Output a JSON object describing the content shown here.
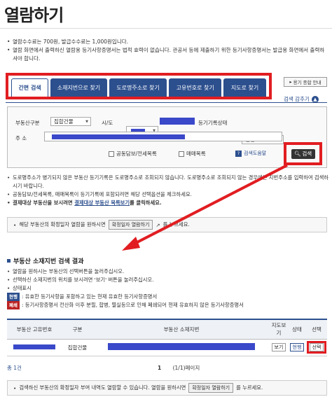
{
  "page": {
    "title": "열람하기"
  },
  "top_notes": [
    "열람수수료는 700원, 발급수수료는 1,000원입니다.",
    "열람 화면에서 출력하신 열람용 등기사항증명서는 법적 효력이 없습니다. 관공서 등에 제출하기 위한 등기사항증명서는 발급용 화면에서 출력하셔야 합니다."
  ],
  "tabs": [
    {
      "label": "간편 검색"
    },
    {
      "label": "소재지번으로 찾기"
    },
    {
      "label": "도로명주소로 찾기"
    },
    {
      "label": "고유번호로 찾기"
    },
    {
      "label": "지도로 찾기"
    }
  ],
  "guide_button": "용기 종합 안내",
  "collapse_label": "검색 감추기",
  "form": {
    "type_label": "부동산구분",
    "type_value": "집합건물",
    "sido_label": "시/도",
    "record_label": "등기기록상태",
    "record_value": "현행",
    "address_label": "주 소",
    "check1": "공동담보/전세목록",
    "check2": "매매목록",
    "help_label": "검색도움말",
    "search_button": "검색"
  },
  "mid_notes": [
    "도로명주소가 병기되지 않은 부동산 등기기록은 도로명주소로 조회되지 않습니다. 도로명주소로 조회되지 않는 경우에는 지번주소를 입력하여 검색하시기 바랍니다.",
    "공동담보/전세목록, 매매목록이 등기기록에 포함되려면 해당 선택옵션을 체크하세요."
  ],
  "batch_note": {
    "prefix": "결제대상 부동산을 보시려면",
    "link": "결제대상 부동산 목록보기",
    "suffix": "를 클릭하세요."
  },
  "confirm_note": {
    "prefix": "해당 부동산의 확정일자 열람을 원하시면",
    "button": "확정일자 열람하기",
    "suffix": "를 누르세요."
  },
  "results": {
    "title": "부동산 소재지번 검색 결과",
    "notes": [
      "열람을 원하시는 부동산의 선택버튼을 눌러주십시오.",
      "선택하신 소재지번의 위치를 보시려면 '보기' 버튼을 눌러주십시오.",
      "상태표시"
    ],
    "tag1": "현행",
    "tag1_text": ": 유효한 등기사항을 포함하고 있는 현재 유효한 등기사항증명서",
    "tag2": "폐쇄",
    "tag2_text": ": 등기사항증명서 전산화 이후 분필, 합병, 멸실등으로 인해 폐쇄되어 현재 유효하지 않은 등기사항증명서",
    "columns": [
      "부동산 고유번호",
      "구분",
      "부동산 소재지번",
      "지도보기",
      "상태",
      "선택"
    ],
    "rows": [
      {
        "kind": "집합건물",
        "map": "보기",
        "status": "현행",
        "select": "선택"
      }
    ],
    "total": "총 1건",
    "page_num": "1",
    "page_info": "(1/1)페이지"
  },
  "bottom_note": {
    "prefix": "검색하신 부동산의 확정일자 부여 내역도 열람할 수 있습니다. 열람을 원하시면",
    "button": "확정일자 열람하기",
    "suffix": "를 누르세요."
  }
}
